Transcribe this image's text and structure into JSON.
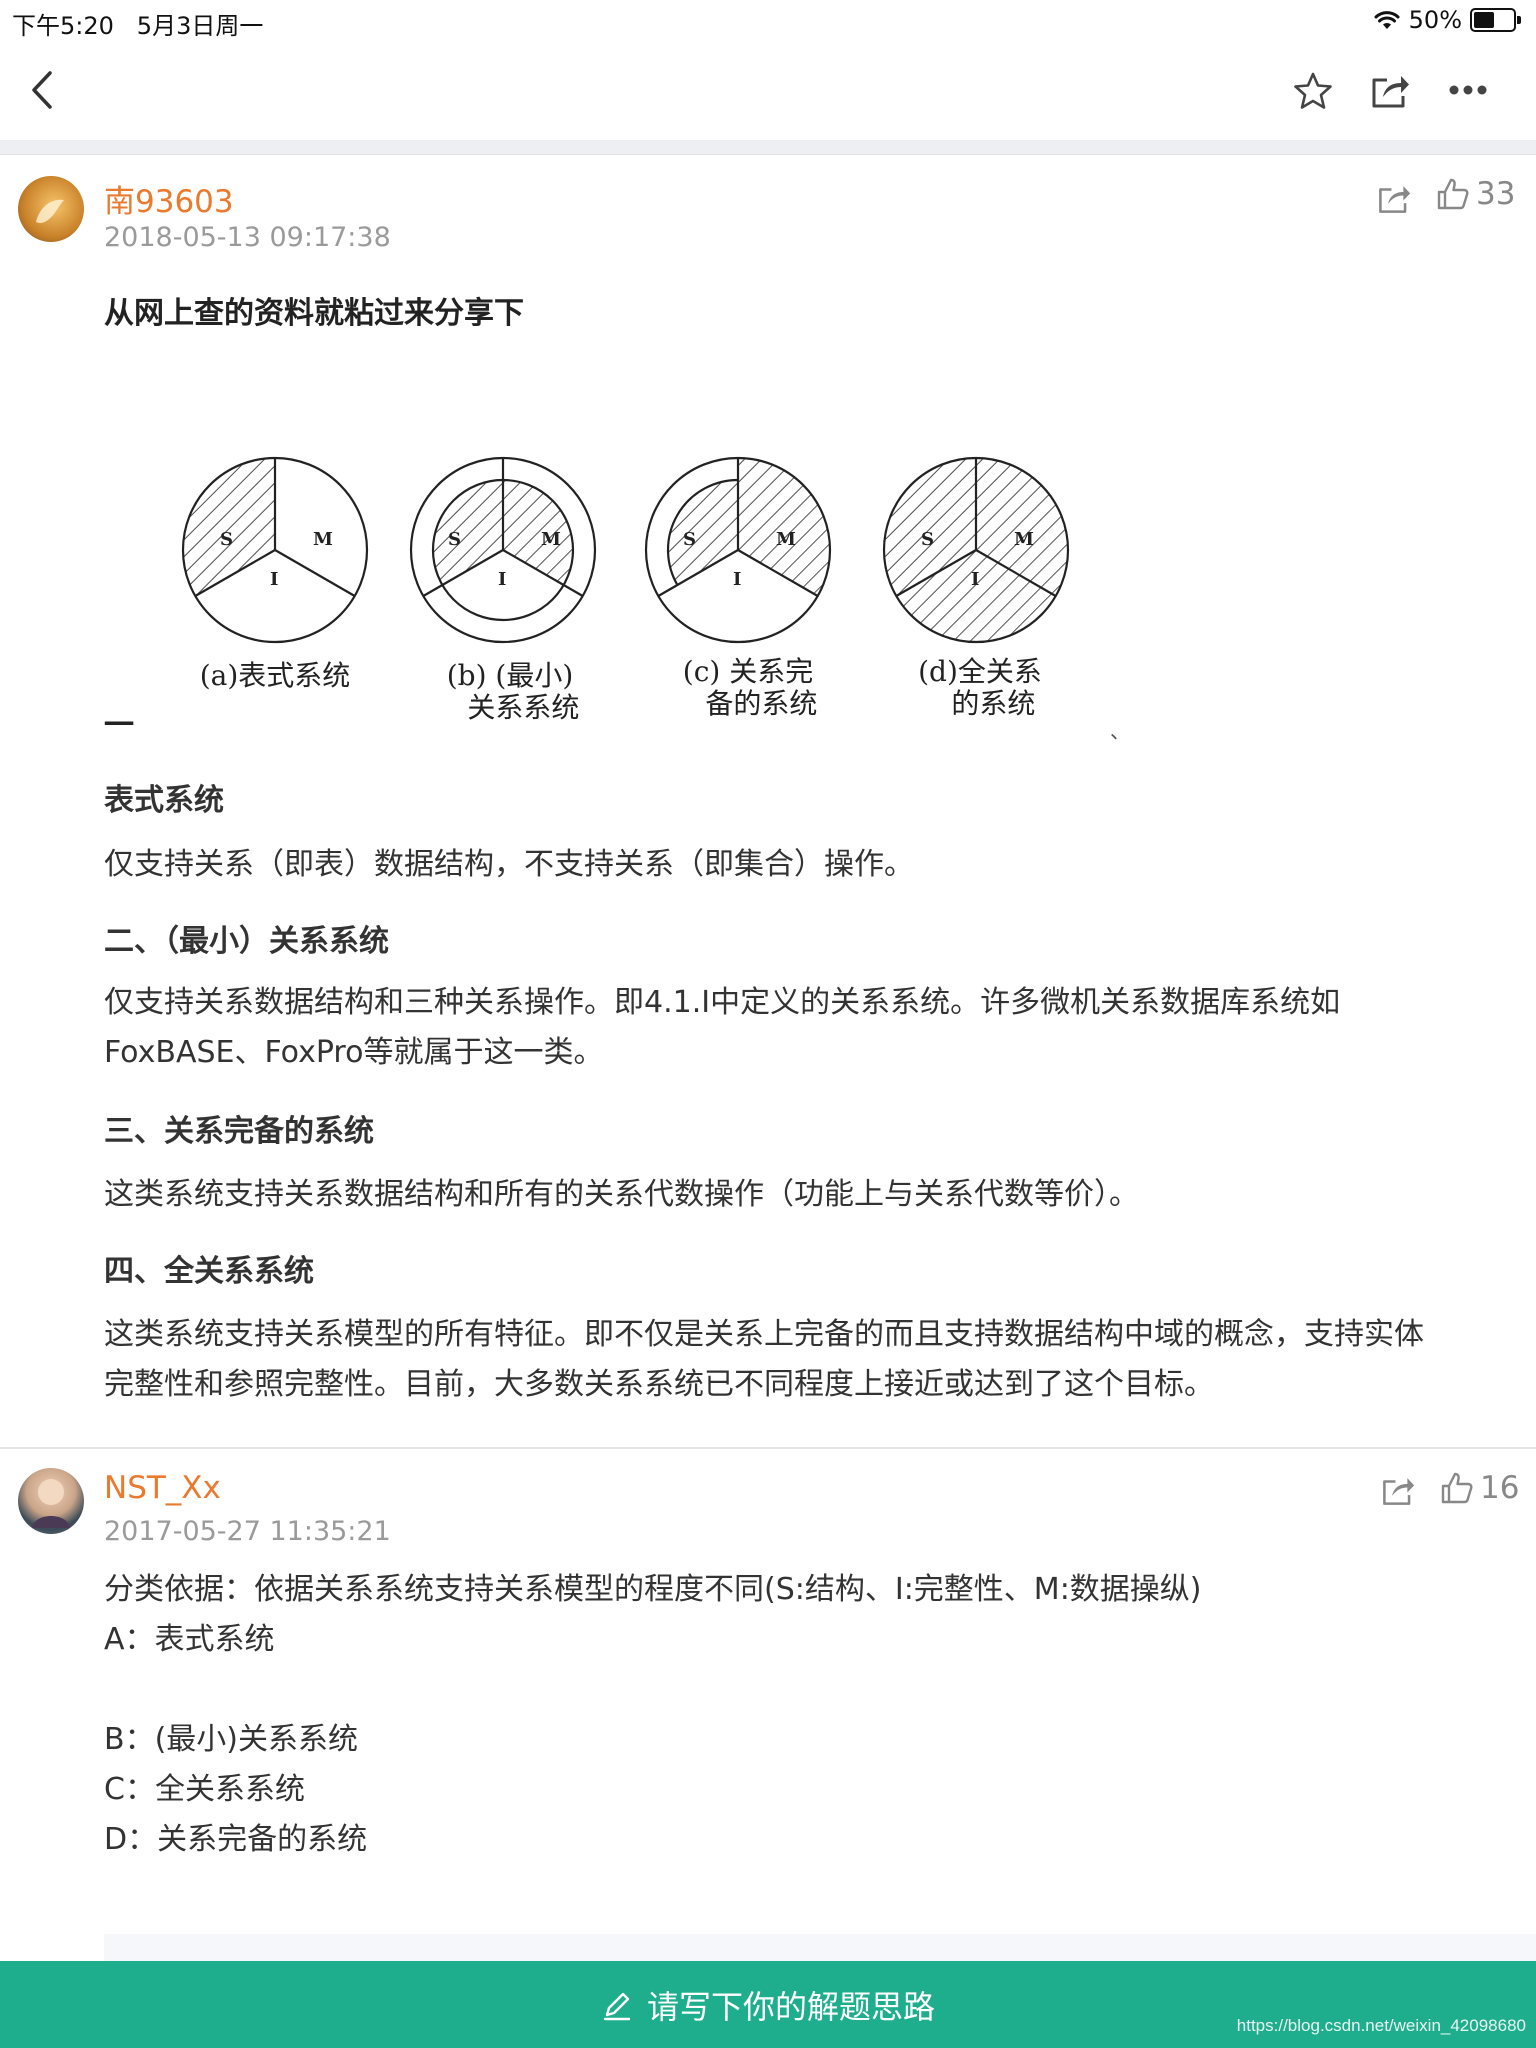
{
  "status_bar": {
    "time": "下午5:20",
    "date": "5月3日周一",
    "battery": "50%"
  },
  "nav": {
    "back_icon": "chevron-left-icon",
    "star_icon": "star-icon",
    "share_icon": "share-icon",
    "more_icon": "more-icon"
  },
  "answers": [
    {
      "username": "南93603",
      "timestamp": "2018-05-13 09:17:38",
      "likes": "33",
      "intro": "从网上查的资料就粘过来分享下",
      "figure": {
        "labels": [
          "(a)表式系统",
          "(b) (最小)\n   关系系统",
          "(c) 关系完\n   备的系统",
          "(d)全关系\n   的系统"
        ],
        "sector_letters": [
          "S",
          "M",
          "I"
        ],
        "stray_mark": "一",
        "stray_mark_right": "、"
      },
      "sections": [
        {
          "heading": "表式系统",
          "body": "仅支持关系（即表）数据结构，不支持关系（即集合）操作。"
        },
        {
          "heading": "二、（最小）关系系统",
          "body_lines": [
            "仅支持关系数据结构和三种关系操作。即4.1.I中定义的关系系统。许多微机关系数据库系统如",
            "FoxBASE、FoxPro等就属于这一类。"
          ]
        },
        {
          "heading": "三、关系完备的系统",
          "body": "这类系统支持关系数据结构和所有的关系代数操作（功能上与关系代数等价）。"
        },
        {
          "heading": "四、全关系系统",
          "body_lines": [
            "这类系统支持关系模型的所有特征。即不仅是关系上完备的而且支持数据结构中域的概念，支持实体",
            "完整性和参照完整性。目前，大多数关系系统已不同程度上接近或达到了这个目标。"
          ]
        }
      ]
    },
    {
      "username": "NST_Xx",
      "timestamp": "2017-05-27 11:35:21",
      "likes": "16",
      "lines": [
        "分类依据：依据关系系统支持关系模型的程度不同(S:结构、I:完整性、M:数据操纵)",
        "A：表式系统",
        "",
        "B：(最小)关系系统",
        "C：全关系系统",
        "D：关系完备的系统"
      ]
    }
  ],
  "bottom_bar": {
    "label": "请写下你的解题思路",
    "icon": "pencil-icon"
  },
  "watermark": "https://blog.csdn.net/weixin_42098680",
  "colors": {
    "accent_orange": "#ea7a2e",
    "bottom_bar_green": "#1eae8e"
  }
}
